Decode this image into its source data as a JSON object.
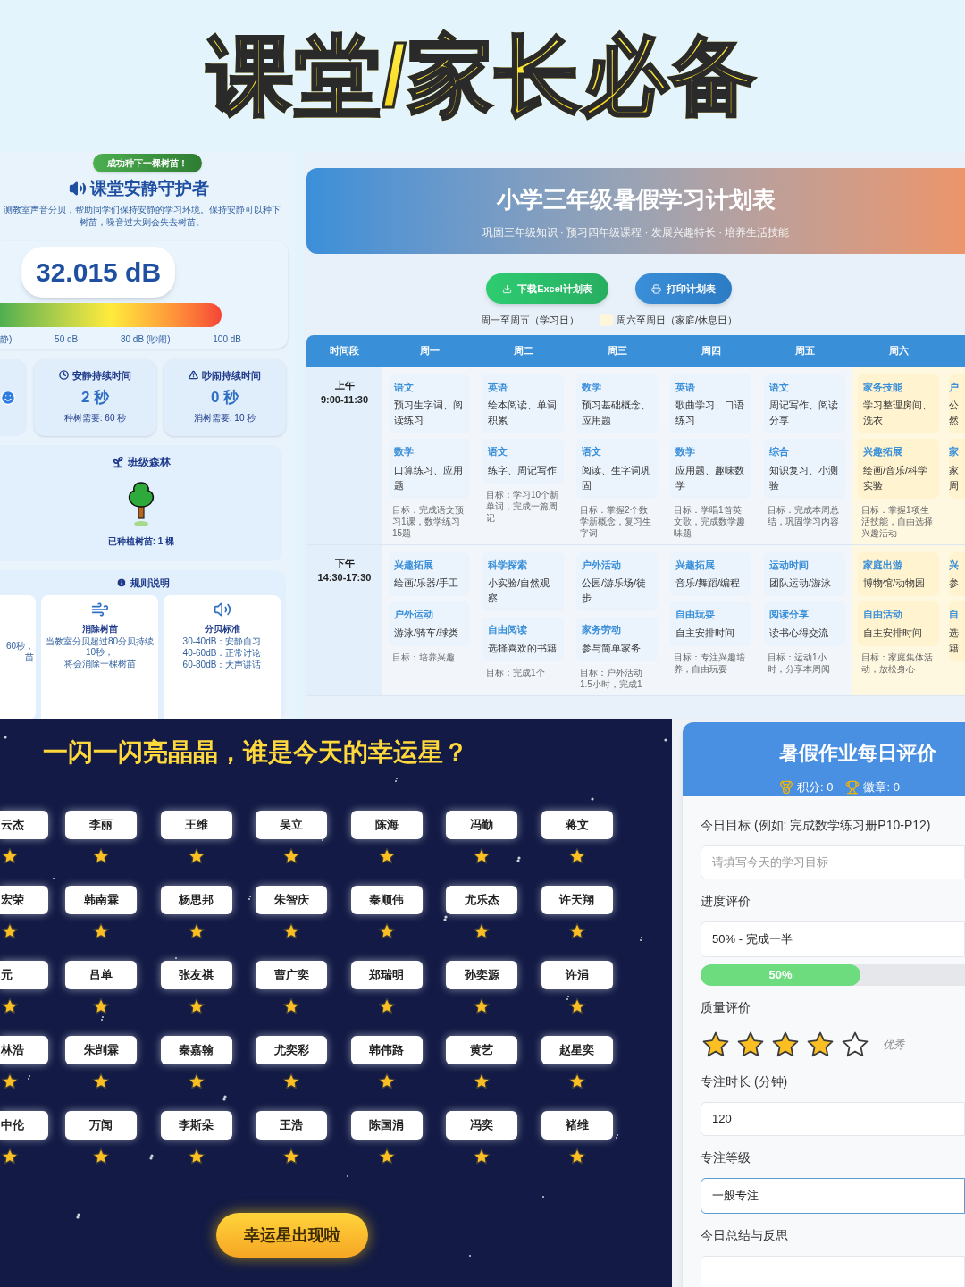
{
  "banner": {
    "title": "课堂/家长必备"
  },
  "noise_monitor": {
    "toast": "成功种下一棵树苗！",
    "title": "课堂安静守护者",
    "description": "测教室声音分贝，帮助同学们保持安静的学习环境。保持安静可以种下树苗，噪音过大则会失去树苗。",
    "reading": "32.015 dB",
    "scale_labels": [
      "静)",
      "50 dB",
      "80 dB (吵闹)",
      "100 dB"
    ],
    "stats": [
      {
        "kind": "mood"
      },
      {
        "kind": "quiet",
        "title": "安静持续时间",
        "value": "2 秒",
        "note": "种树需要: 60 秒"
      },
      {
        "kind": "noisy",
        "title": "吵闹持续时间",
        "value": "0 秒",
        "note": "消树需要: 10 秒"
      }
    ],
    "forest": {
      "title": "班级森林",
      "trees_label": "已种植树苗: 1 棵"
    },
    "rules": {
      "title": "规则说明",
      "cards": [
        {
          "kind": "plant",
          "lines": [
            "60秒，",
            "苗"
          ]
        },
        {
          "kind": "remove",
          "title": "消除树苗",
          "lines": [
            "当教室分贝超过80分贝持续10秒，",
            "将会消除一棵树苗"
          ]
        },
        {
          "kind": "standard",
          "title": "分贝标准",
          "lines": [
            "30-40dB：安静自习",
            "40-60dB：正常讨论",
            "60-80dB：大声讲话"
          ]
        }
      ]
    }
  },
  "schedule": {
    "title": "小学三年级暑假学习计划表",
    "subtitle": "巩固三年级知识 · 预习四年级课程 · 发展兴趣特长 · 培养生活技能",
    "buttons": [
      {
        "kind": "download",
        "label": "下载Excel计划表"
      },
      {
        "kind": "print",
        "label": "打印计划表"
      }
    ],
    "legend": [
      {
        "label": "周一至周五（学习日）"
      },
      {
        "label": "周六至周日（家庭/休息日）",
        "color": "#fff5d9"
      }
    ],
    "time_header": "时间段",
    "columns": [
      "周一",
      "周二",
      "周三",
      "周四",
      "周五",
      "周六"
    ],
    "rows": [
      {
        "period": "上午",
        "time": "9:00-11:30",
        "cells": [
          {
            "weekend": false,
            "activities": [
              {
                "subject": "语文",
                "task": "预习生字词、阅读练习"
              },
              {
                "subject": "数学",
                "task": "口算练习、应用题"
              }
            ],
            "goal": "目标：完成语文预习1课，数学练习15题"
          },
          {
            "weekend": false,
            "activities": [
              {
                "subject": "英语",
                "task": "绘本阅读、单词积累"
              },
              {
                "subject": "语文",
                "task": "练字、周记写作"
              }
            ],
            "goal": "目标：学习10个新单词，完成一篇周记"
          },
          {
            "weekend": false,
            "activities": [
              {
                "subject": "数学",
                "task": "预习基础概念、应用题"
              },
              {
                "subject": "语文",
                "task": "阅读、生字词巩固"
              }
            ],
            "goal": "目标：掌握2个数学新概念，复习生字词"
          },
          {
            "weekend": false,
            "activities": [
              {
                "subject": "英语",
                "task": "歌曲学习、口语练习"
              },
              {
                "subject": "数学",
                "task": "应用题、趣味数学"
              }
            ],
            "goal": "目标：学唱1首英文歌，完成数学趣味题"
          },
          {
            "weekend": false,
            "activities": [
              {
                "subject": "语文",
                "task": "周记写作、阅读分享"
              },
              {
                "subject": "综合",
                "task": "知识复习、小测验"
              }
            ],
            "goal": "目标：完成本周总结，巩固学习内容"
          },
          {
            "weekend": true,
            "activities": [
              {
                "subject": "家务技能",
                "task": "学习整理房间、洗衣"
              },
              {
                "subject": "兴趣拓展",
                "task": "绘画/音乐/科学实验"
              }
            ],
            "goal": "目标：掌握1项生活技能，自由选择兴趣活动"
          },
          {
            "weekend": true,
            "activities": [
              {
                "subject": "户",
                "task": "公然"
              },
              {
                "subject": "家",
                "task": "家周"
              }
            ]
          }
        ]
      },
      {
        "period": "下午",
        "time": "14:30-17:30",
        "cells": [
          {
            "weekend": false,
            "activities": [
              {
                "subject": "兴趣拓展",
                "task": "绘画/乐器/手工"
              },
              {
                "subject": "户外运动",
                "task": "游泳/骑车/球类"
              }
            ],
            "goal": "目标：培养兴趣"
          },
          {
            "weekend": false,
            "activities": [
              {
                "subject": "科学探索",
                "task": "小实验/自然观察"
              },
              {
                "subject": "自由阅读",
                "task": "选择喜欢的书籍"
              }
            ],
            "goal": "目标：完成1个"
          },
          {
            "weekend": false,
            "activities": [
              {
                "subject": "户外活动",
                "task": "公园/游乐场/徒步"
              },
              {
                "subject": "家务劳动",
                "task": "参与简单家务"
              }
            ],
            "goal": "目标：户外活动1.5小时，完成1"
          },
          {
            "weekend": false,
            "activities": [
              {
                "subject": "兴趣拓展",
                "task": "音乐/舞蹈/编程"
              },
              {
                "subject": "自由玩耍",
                "task": "自主安排时间"
              }
            ],
            "goal": "目标：专注兴趣培养，自由玩耍"
          },
          {
            "weekend": false,
            "activities": [
              {
                "subject": "运动时间",
                "task": "团队运动/游泳"
              },
              {
                "subject": "阅读分享",
                "task": "读书心得交流"
              }
            ],
            "goal": "目标：运动1小时，分享本周阅"
          },
          {
            "weekend": true,
            "activities": [
              {
                "subject": "家庭出游",
                "task": "博物馆/动物园"
              },
              {
                "subject": "自由活动",
                "task": "自主安排时间"
              }
            ],
            "goal": "目标：家庭集体活动，放松身心"
          },
          {
            "weekend": true,
            "activities": [
              {
                "subject": "兴",
                "task": "参"
              },
              {
                "subject": "自",
                "task": "选籍"
              }
            ]
          }
        ]
      }
    ]
  },
  "lucky_star": {
    "title": "一闪一闪亮晶晶，谁是今天的幸运星？",
    "rows": [
      [
        "云杰",
        "李丽",
        "王维",
        "吴立",
        "陈海",
        "冯勤",
        "蒋文"
      ],
      [
        "宏荣",
        "韩南霖",
        "杨思邦",
        "朱智庆",
        "秦顺伟",
        "尤乐杰",
        "许天翔"
      ],
      [
        "元",
        "吕单",
        "张友祺",
        "曹广奕",
        "郑瑞明",
        "孙奕源",
        "许涓"
      ],
      [
        "林浩",
        "朱剀霖",
        "秦嘉翰",
        "尤奕彩",
        "韩伟路",
        "黄艺",
        "赵星奕"
      ],
      [
        "中伦",
        "万闻",
        "李斯朵",
        "王浩",
        "陈国涓",
        "冯奕",
        "褚维"
      ]
    ],
    "button": "幸运星出现啦"
  },
  "evaluation": {
    "title": "暑假作业每日评价",
    "points": "积分: 0",
    "badges": "徽章: 0",
    "fields": [
      {
        "kind": "input",
        "label": "今日目标 (例如: 完成数学练习册P10-P12)",
        "placeholder": "请填写今天的学习目标",
        "focused": false
      },
      {
        "kind": "select",
        "label": "进度评价",
        "value": "50% - 完成一半",
        "focused": false
      },
      {
        "kind": "progress",
        "level": 0.5,
        "text": "50%"
      },
      {
        "kind": "rating",
        "label": "质量评价",
        "stars": 4,
        "rating_text": "优秀"
      },
      {
        "kind": "input",
        "label": "专注时长 (分钟)",
        "value": "120",
        "focused": false
      },
      {
        "kind": "select",
        "label": "专注等级",
        "value": "一般专注",
        "focused": true
      },
      {
        "kind": "textarea",
        "label": "今日总结与反思"
      }
    ]
  }
}
